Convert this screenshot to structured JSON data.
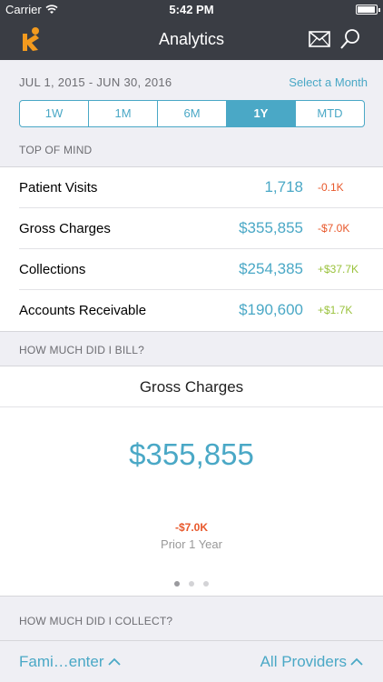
{
  "status_bar": {
    "carrier": "Carrier",
    "time": "5:42 PM"
  },
  "nav": {
    "title": "Analytics",
    "logo_icon": "kareo-logo-icon",
    "mail_icon": "mail-icon",
    "search_icon": "search-icon"
  },
  "range": {
    "date_range": "JUL 1, 2015 - JUN 30, 2016",
    "select_month_label": "Select a Month",
    "segments": [
      "1W",
      "1M",
      "6M",
      "1Y",
      "MTD"
    ],
    "active_segment": "1Y"
  },
  "top_of_mind": {
    "header": "TOP OF MIND",
    "rows": [
      {
        "label": "Patient Visits",
        "value": "1,718",
        "delta": "-0.1K",
        "trend": "negative"
      },
      {
        "label": "Gross Charges",
        "value": "$355,855",
        "delta": "-$7.0K",
        "trend": "negative"
      },
      {
        "label": "Collections",
        "value": "$254,385",
        "delta": "+$37.7K",
        "trend": "positive"
      },
      {
        "label": "Accounts Receivable",
        "value": "$190,600",
        "delta": "+$1.7K",
        "trend": "positive"
      }
    ]
  },
  "bill_section": {
    "header": "HOW MUCH DID I BILL?",
    "card_title": "Gross Charges",
    "value": "$355,855",
    "delta": "-$7.0K",
    "period": "Prior 1 Year",
    "page_count": 3,
    "active_page": 1
  },
  "collect_section": {
    "header": "HOW MUCH DID I COLLECT?"
  },
  "bottom_bar": {
    "practice_label": "Fami…enter",
    "providers_label": "All Providers"
  },
  "colors": {
    "accent": "#4aa8c6",
    "navbar": "#3a3d44",
    "negative": "#e8582b",
    "positive": "#9ac23c",
    "logo": "#f39a1e"
  }
}
